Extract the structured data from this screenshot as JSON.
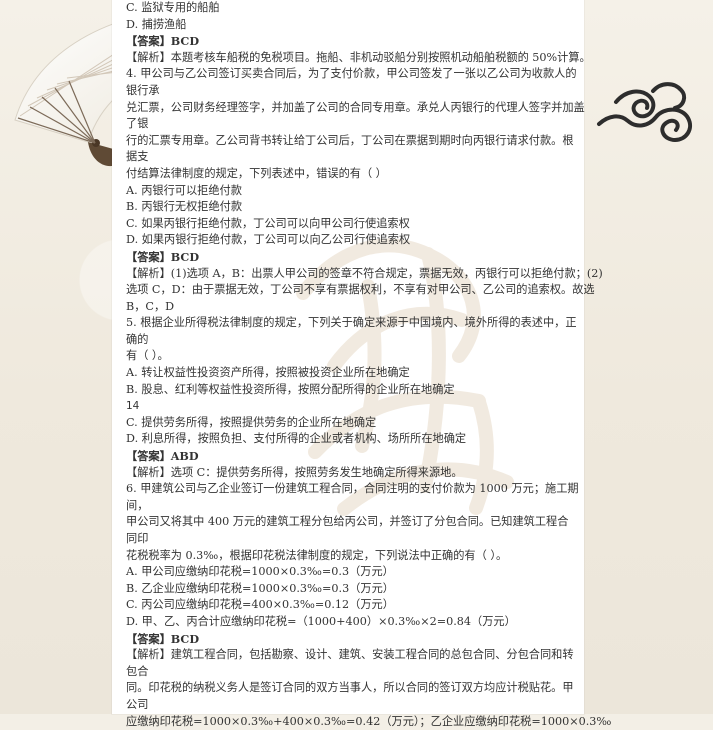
{
  "lines": [
    "C. 监狱专用的船舶",
    "D. 捕捞渔船",
    "【答案】BCD",
    "【解析】本题考核车船税的免税项目。拖船、非机动驳船分别按照机动船舶税额的 50%计算。",
    "4. 甲公司与乙公司签订买卖合同后，为了支付价款，甲公司签发了一张以乙公司为收款人的",
    "银行承",
    "兑汇票，公司财务经理签字，并加盖了公司的合同专用章。承兑人丙银行的代理人签字并加盖",
    "了银",
    "行的汇票专用章。乙公司背书转让给丁公司后，丁公司在票据到期时向丙银行请求付款。根",
    "据支",
    "付结算法律制度的规定，下列表述中，错误的有（ ）",
    "A. 丙银行可以拒绝付款",
    "B. 丙银行无权拒绝付款",
    "C. 如果丙银行拒绝付款，丁公司可以向甲公司行使追索权",
    "D. 如果丙银行拒绝付款，丁公司可以向乙公司行使追索权",
    "【答案】BCD",
    "【解析】(1)选项 A，B：出票人甲公司的签章不符合规定，票据无效，丙银行可以拒绝付款；(2)",
    "选项 C，D：由于票据无效，丁公司不享有票据权利，不享有对甲公司、乙公司的追索权。故选",
    "B，C，D",
    "5. 根据企业所得税法律制度的规定，下列关于确定来源于中国境内、境外所得的表述中，正",
    "确的",
    "有（ ）。",
    "A. 转让权益性投资资产所得，按照被投资企业所在地确定",
    "B. 股息、红利等权益性投资所得，按照分配所得的企业所在地确定",
    "14",
    "C. 提供劳务所得，按照提供劳务的企业所在地确定",
    "D. 利息所得，按照负担、支付所得的企业或者机构、场所所在地确定",
    "【答案】ABD",
    "【解析】选项 C：提供劳务所得，按照劳务发生地确定所得来源地。",
    "6. 甲建筑公司与乙企业签订一份建筑工程合同，合同注明的支付价款为 1000 万元；施工期",
    "间，",
    "甲公司又将其中 400 万元的建筑工程分包给丙公司，并签订了分包合同。已知建筑工程合",
    "同印",
    "花税税率为 0.3‰，根据印花税法律制度的规定，下列说法中正确的有（ ）。",
    "A. 甲公司应缴纳印花税=1000×0.3‰=0.3（万元）",
    "B. 乙企业应缴纳印花税=1000×0.3‰=0.3（万元）",
    "C. 丙公司应缴纳印花税=400×0.3‰=0.12（万元）",
    "D. 甲、乙、丙合计应缴纳印花税=（1000+400）×0.3‰×2=0.84（万元）",
    "【答案】BCD",
    "【解析】建筑工程合同，包括勘察、设计、建筑、安装工程合同的总包合同、分包合同和转",
    "包合",
    "同。印花税的纳税义务人是签订合同的双方当事人，所以合同的签订双方均应计税贴花。甲",
    "公司",
    "应缴纳印花税=1000×0.3‰+400×0.3‰=0.42（万元）；乙企业应缴纳印花税=1000×0.3‰"
  ]
}
